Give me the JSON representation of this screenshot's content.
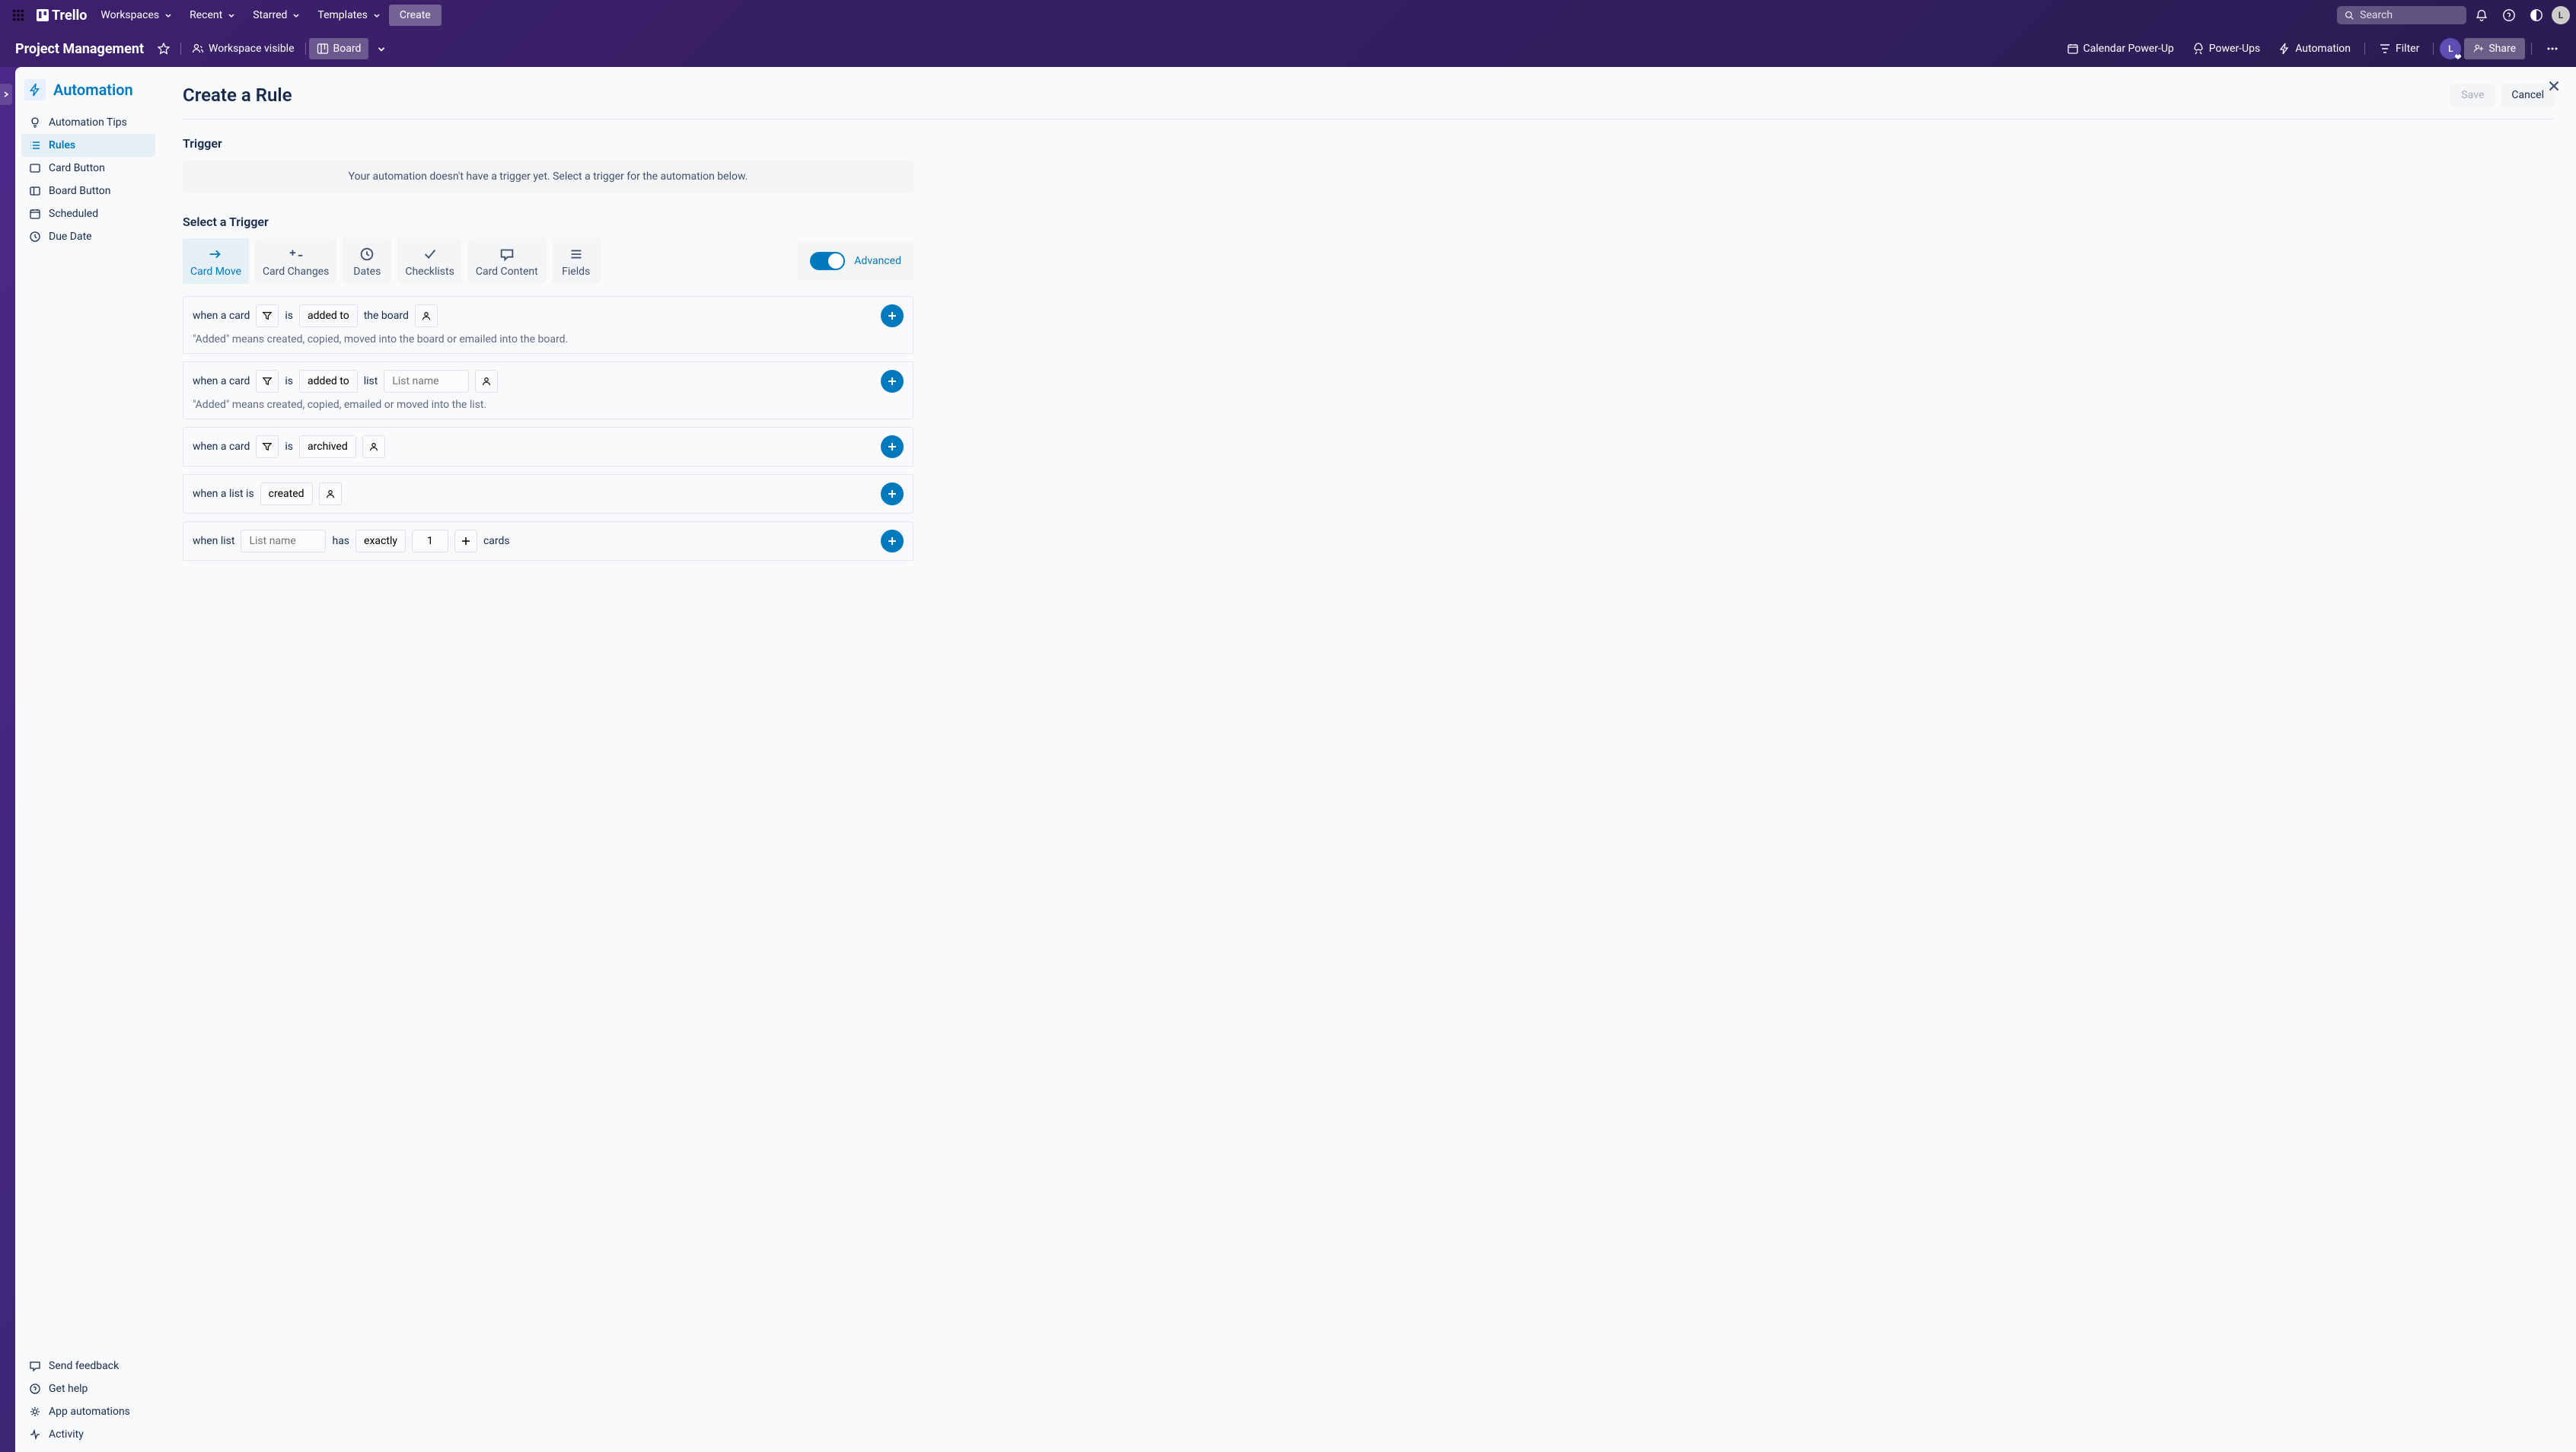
{
  "topnav": {
    "brand": "Trello",
    "links": [
      "Workspaces",
      "Recent",
      "Starred",
      "Templates"
    ],
    "create": "Create",
    "search_placeholder": "Search",
    "avatar_letter": "L"
  },
  "board_header": {
    "name": "Project Management",
    "workspace_visible": "Workspace visible",
    "board": "Board",
    "calendar": "Calendar Power-Up",
    "powerups": "Power-Ups",
    "automation": "Automation",
    "filter": "Filter",
    "share": "Share",
    "avatar_letter": "L"
  },
  "sidebar": {
    "title": "Automation",
    "items": [
      {
        "label": "Automation Tips"
      },
      {
        "label": "Rules"
      },
      {
        "label": "Card Button"
      },
      {
        "label": "Board Button"
      },
      {
        "label": "Scheduled"
      },
      {
        "label": "Due Date"
      }
    ],
    "bottom": [
      {
        "label": "Send feedback"
      },
      {
        "label": "Get help"
      },
      {
        "label": "App automations"
      },
      {
        "label": "Activity"
      }
    ]
  },
  "content": {
    "title": "Create a Rule",
    "save": "Save",
    "cancel": "Cancel",
    "trigger_label": "Trigger",
    "trigger_empty": "Your automation doesn't have a trigger yet. Select a trigger for the automation below.",
    "select_trigger": "Select a Trigger",
    "tabs": [
      "Card Move",
      "Card Changes",
      "Dates",
      "Checklists",
      "Card Content",
      "Fields"
    ],
    "advanced": "Advanced",
    "rows": {
      "r1": {
        "prefix": "when a card",
        "is": "is",
        "added_to": "added to",
        "board": "the board",
        "help": "\"Added\" means created, copied, moved into the board or emailed into the board."
      },
      "r2": {
        "prefix": "when a card",
        "is": "is",
        "added_to": "added to",
        "list": "list",
        "list_placeholder": "List name",
        "help": "\"Added\" means created, copied, emailed or moved into the list."
      },
      "r3": {
        "prefix": "when a card",
        "is": "is",
        "archived": "archived"
      },
      "r4": {
        "prefix": "when a list is",
        "created": "created"
      },
      "r5": {
        "prefix": "when list",
        "list_placeholder": "List name",
        "has": "has",
        "exactly": "exactly",
        "value": "1",
        "cards": "cards"
      }
    }
  }
}
